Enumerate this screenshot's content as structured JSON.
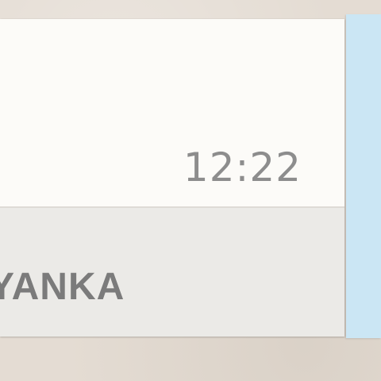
{
  "message": {
    "time": "12:22",
    "sender_name": "YANKA"
  },
  "colors": {
    "incoming_bubble": "#fcfbf8",
    "sender_bar": "#ebeae7",
    "outgoing_bubble": "#cbe6f4",
    "wallpaper": "#e4dcd3",
    "timestamp_text": "#8d8d8d",
    "sender_text": "#7b7b7b"
  }
}
